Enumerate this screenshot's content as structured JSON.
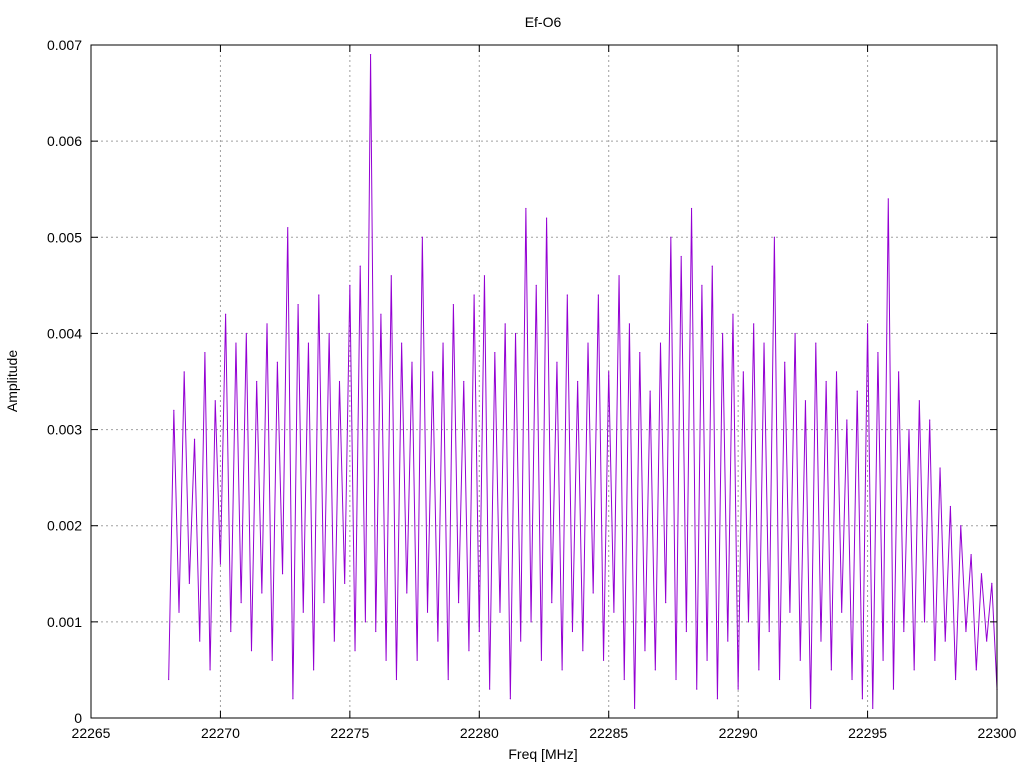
{
  "chart_data": {
    "type": "line",
    "title": "Ef-O6",
    "xlabel": "Freq [MHz]",
    "ylabel": "Amplitude",
    "xlim": [
      22265,
      22300
    ],
    "ylim": [
      0,
      0.007
    ],
    "xticks": [
      22265,
      22270,
      22275,
      22280,
      22285,
      22290,
      22295,
      22300
    ],
    "yticks": [
      0,
      0.001,
      0.002,
      0.003,
      0.004,
      0.005,
      0.006,
      0.007
    ],
    "xtick_labels": [
      "22265",
      "22270",
      "22275",
      "22280",
      "22285",
      "22290",
      "22295",
      "22300"
    ],
    "ytick_labels": [
      "0",
      "0.001",
      "0.002",
      "0.003",
      "0.004",
      "0.005",
      "0.006",
      "0.007"
    ],
    "grid": true,
    "legend": "none",
    "series": [
      {
        "color": "#9400d3",
        "x": [
          22268.0,
          22268.2,
          22268.4,
          22268.6,
          22268.8,
          22269.0,
          22269.2,
          22269.4,
          22269.6,
          22269.8,
          22270.0,
          22270.2,
          22270.4,
          22270.6,
          22270.8,
          22271.0,
          22271.2,
          22271.4,
          22271.6,
          22271.8,
          22272.0,
          22272.2,
          22272.4,
          22272.6,
          22272.8,
          22273.0,
          22273.2,
          22273.4,
          22273.6,
          22273.8,
          22274.0,
          22274.2,
          22274.4,
          22274.6,
          22274.8,
          22275.0,
          22275.2,
          22275.4,
          22275.6,
          22275.8,
          22276.0,
          22276.2,
          22276.4,
          22276.6,
          22276.8,
          22277.0,
          22277.2,
          22277.4,
          22277.6,
          22277.8,
          22278.0,
          22278.2,
          22278.4,
          22278.6,
          22278.8,
          22279.0,
          22279.2,
          22279.4,
          22279.6,
          22279.8,
          22280.0,
          22280.2,
          22280.4,
          22280.6,
          22280.8,
          22281.0,
          22281.2,
          22281.4,
          22281.6,
          22281.8,
          22282.0,
          22282.2,
          22282.4,
          22282.6,
          22282.8,
          22283.0,
          22283.2,
          22283.4,
          22283.6,
          22283.8,
          22284.0,
          22284.2,
          22284.4,
          22284.6,
          22284.8,
          22285.0,
          22285.2,
          22285.4,
          22285.6,
          22285.8,
          22286.0,
          22286.2,
          22286.4,
          22286.6,
          22286.8,
          22287.0,
          22287.2,
          22287.4,
          22287.6,
          22287.8,
          22288.0,
          22288.2,
          22288.4,
          22288.6,
          22288.8,
          22289.0,
          22289.2,
          22289.4,
          22289.6,
          22289.8,
          22290.0,
          22290.2,
          22290.4,
          22290.6,
          22290.8,
          22291.0,
          22291.2,
          22291.4,
          22291.6,
          22291.8,
          22292.0,
          22292.2,
          22292.4,
          22292.6,
          22292.8,
          22293.0,
          22293.2,
          22293.4,
          22293.6,
          22293.8,
          22294.0,
          22294.2,
          22294.4,
          22294.6,
          22294.8,
          22295.0,
          22295.2,
          22295.4,
          22295.6,
          22295.8,
          22296.0,
          22296.2,
          22296.4,
          22296.6,
          22296.8,
          22297.0,
          22297.2,
          22297.4,
          22297.6,
          22297.8,
          22298.0,
          22298.2,
          22298.4,
          22298.6,
          22298.8,
          22299.0,
          22299.2,
          22299.4,
          22299.6,
          22299.8,
          22300.0
        ],
        "y": [
          0.0004,
          0.0032,
          0.0011,
          0.0036,
          0.0014,
          0.0029,
          0.0008,
          0.0038,
          0.0005,
          0.0033,
          0.0016,
          0.0042,
          0.0009,
          0.0039,
          0.0012,
          0.004,
          0.0007,
          0.0035,
          0.0013,
          0.0041,
          0.0006,
          0.0037,
          0.0015,
          0.0051,
          0.0002,
          0.0043,
          0.0011,
          0.0039,
          0.0005,
          0.0044,
          0.0012,
          0.004,
          0.0008,
          0.0035,
          0.0014,
          0.0045,
          0.0007,
          0.0047,
          0.001,
          0.0069,
          0.0009,
          0.0042,
          0.0006,
          0.0046,
          0.0004,
          0.0039,
          0.0013,
          0.0037,
          0.0006,
          0.005,
          0.0011,
          0.0036,
          0.0008,
          0.0039,
          0.0004,
          0.0043,
          0.0012,
          0.0035,
          0.0007,
          0.0044,
          0.0009,
          0.0046,
          0.0003,
          0.0038,
          0.0011,
          0.0041,
          0.0002,
          0.004,
          0.0008,
          0.0053,
          0.001,
          0.0045,
          0.0006,
          0.0052,
          0.0012,
          0.0037,
          0.0005,
          0.0044,
          0.0009,
          0.0035,
          0.0007,
          0.0039,
          0.0013,
          0.0044,
          0.0006,
          0.0036,
          0.0011,
          0.0046,
          0.0004,
          0.0041,
          0.0001,
          0.0038,
          0.0007,
          0.0034,
          0.0005,
          0.0039,
          0.0012,
          0.005,
          0.0004,
          0.0048,
          0.0009,
          0.0053,
          0.0003,
          0.0045,
          0.0006,
          0.0047,
          0.0002,
          0.004,
          0.0008,
          0.0042,
          0.0003,
          0.0036,
          0.001,
          0.0041,
          0.0005,
          0.0039,
          0.0009,
          0.005,
          0.0004,
          0.0037,
          0.0011,
          0.004,
          0.0006,
          0.0033,
          0.0001,
          0.0039,
          0.0008,
          0.0035,
          0.0005,
          0.0036,
          0.0011,
          0.0031,
          0.0004,
          0.0034,
          0.0002,
          0.0041,
          0.0001,
          0.0038,
          0.0006,
          0.0054,
          0.0003,
          0.0036,
          0.0009,
          0.003,
          0.0005,
          0.0033,
          0.001,
          0.0031,
          0.0006,
          0.0026,
          0.0008,
          0.0022,
          0.0004,
          0.002,
          0.0009,
          0.0017,
          0.0005,
          0.0015,
          0.0008,
          0.0014,
          0.0003
        ]
      }
    ]
  }
}
